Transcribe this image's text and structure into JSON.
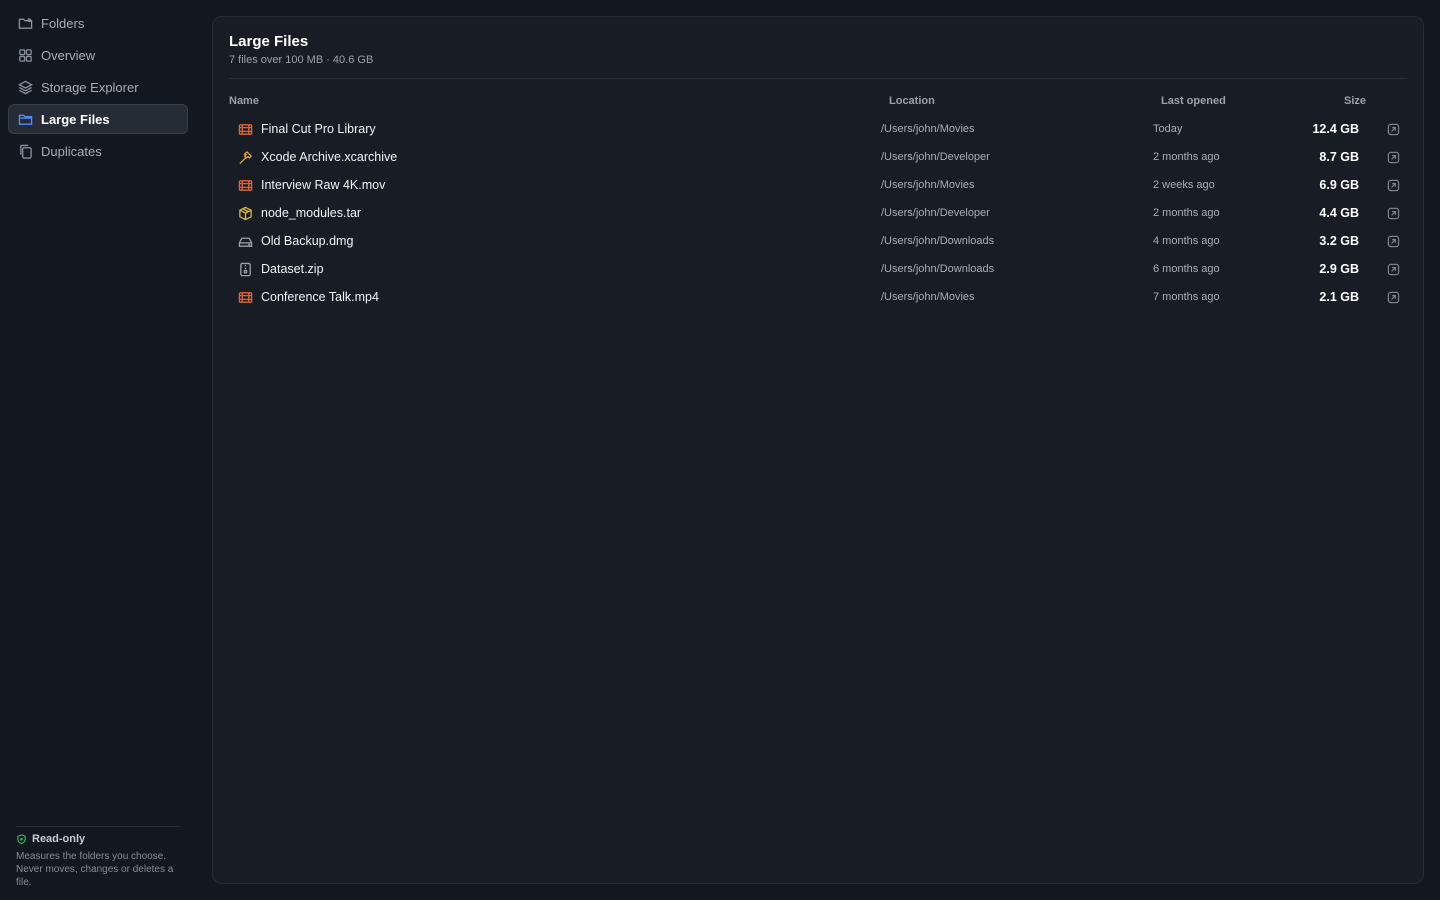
{
  "sidebar": {
    "items": [
      {
        "label": "Folders",
        "icon": "folder-icon"
      },
      {
        "label": "Overview",
        "icon": "grid-icon"
      },
      {
        "label": "Storage Explorer",
        "icon": "layers-icon"
      },
      {
        "label": "Large Files",
        "icon": "folder-icon",
        "active": true
      },
      {
        "label": "Duplicates",
        "icon": "copy-icon"
      }
    ],
    "footer": {
      "badge": "Read-only",
      "description": "Measures the folders you choose. Never moves, changes or deletes a file."
    }
  },
  "main": {
    "title": "Large Files",
    "subtitle": "7 files over 100 MB · 40.6 GB",
    "columns": {
      "name": "Name",
      "location": "Location",
      "last_opened": "Last opened",
      "size": "Size"
    },
    "files": [
      {
        "name": "Final Cut Pro Library",
        "icon": "film-icon",
        "location": "/Users/john/Movies",
        "last_opened": "Today",
        "size": "12.4 GB"
      },
      {
        "name": "Xcode Archive.xcarchive",
        "icon": "hammer-icon",
        "location": "/Users/john/Developer",
        "last_opened": "2 months ago",
        "size": "8.7 GB"
      },
      {
        "name": "Interview Raw 4K.mov",
        "icon": "film-icon",
        "location": "/Users/john/Movies",
        "last_opened": "2 weeks ago",
        "size": "6.9 GB"
      },
      {
        "name": "node_modules.tar",
        "icon": "package-icon",
        "location": "/Users/john/Developer",
        "last_opened": "2 months ago",
        "size": "4.4 GB"
      },
      {
        "name": "Old Backup.dmg",
        "icon": "disk-icon",
        "location": "/Users/john/Downloads",
        "last_opened": "4 months ago",
        "size": "3.2 GB"
      },
      {
        "name": "Dataset.zip",
        "icon": "zip-icon",
        "location": "/Users/john/Downloads",
        "last_opened": "6 months ago",
        "size": "2.9 GB"
      },
      {
        "name": "Conference Talk.mp4",
        "icon": "film-icon",
        "location": "/Users/john/Movies",
        "last_opened": "7 months ago",
        "size": "2.1 GB"
      }
    ]
  },
  "colors": {
    "accent": "#4d8dff",
    "film": "#e8622c",
    "hammer": "#e0a82e",
    "package": "#e0b82e",
    "neutral_icon": "#9aa1ac",
    "readonly_green": "#3fbf5f"
  }
}
